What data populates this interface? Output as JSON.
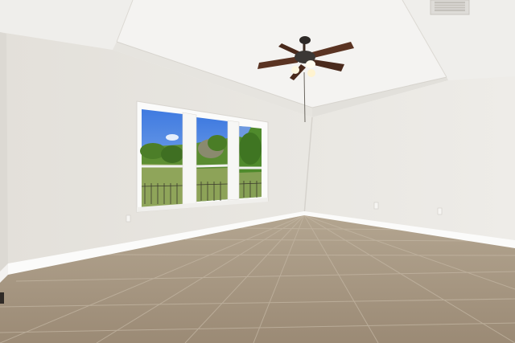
{
  "scene": {
    "kind": "photo",
    "subject": "empty-room",
    "objects": [
      "tray-ceiling",
      "ceiling-fan",
      "air-vent",
      "triple-window",
      "tile-floor",
      "baseboards",
      "wall-outlets"
    ],
    "colors": {
      "ceiling": "#f1f0ee",
      "wall_left": "#e7e5e0",
      "wall_right": "#edebe6",
      "floor": "#a99985",
      "grout": "#c6b8a5",
      "trim": "#fbfbfa",
      "sky": "#4f86de",
      "foliage": "#5b8d2f",
      "fan": "#4d2e20"
    }
  }
}
